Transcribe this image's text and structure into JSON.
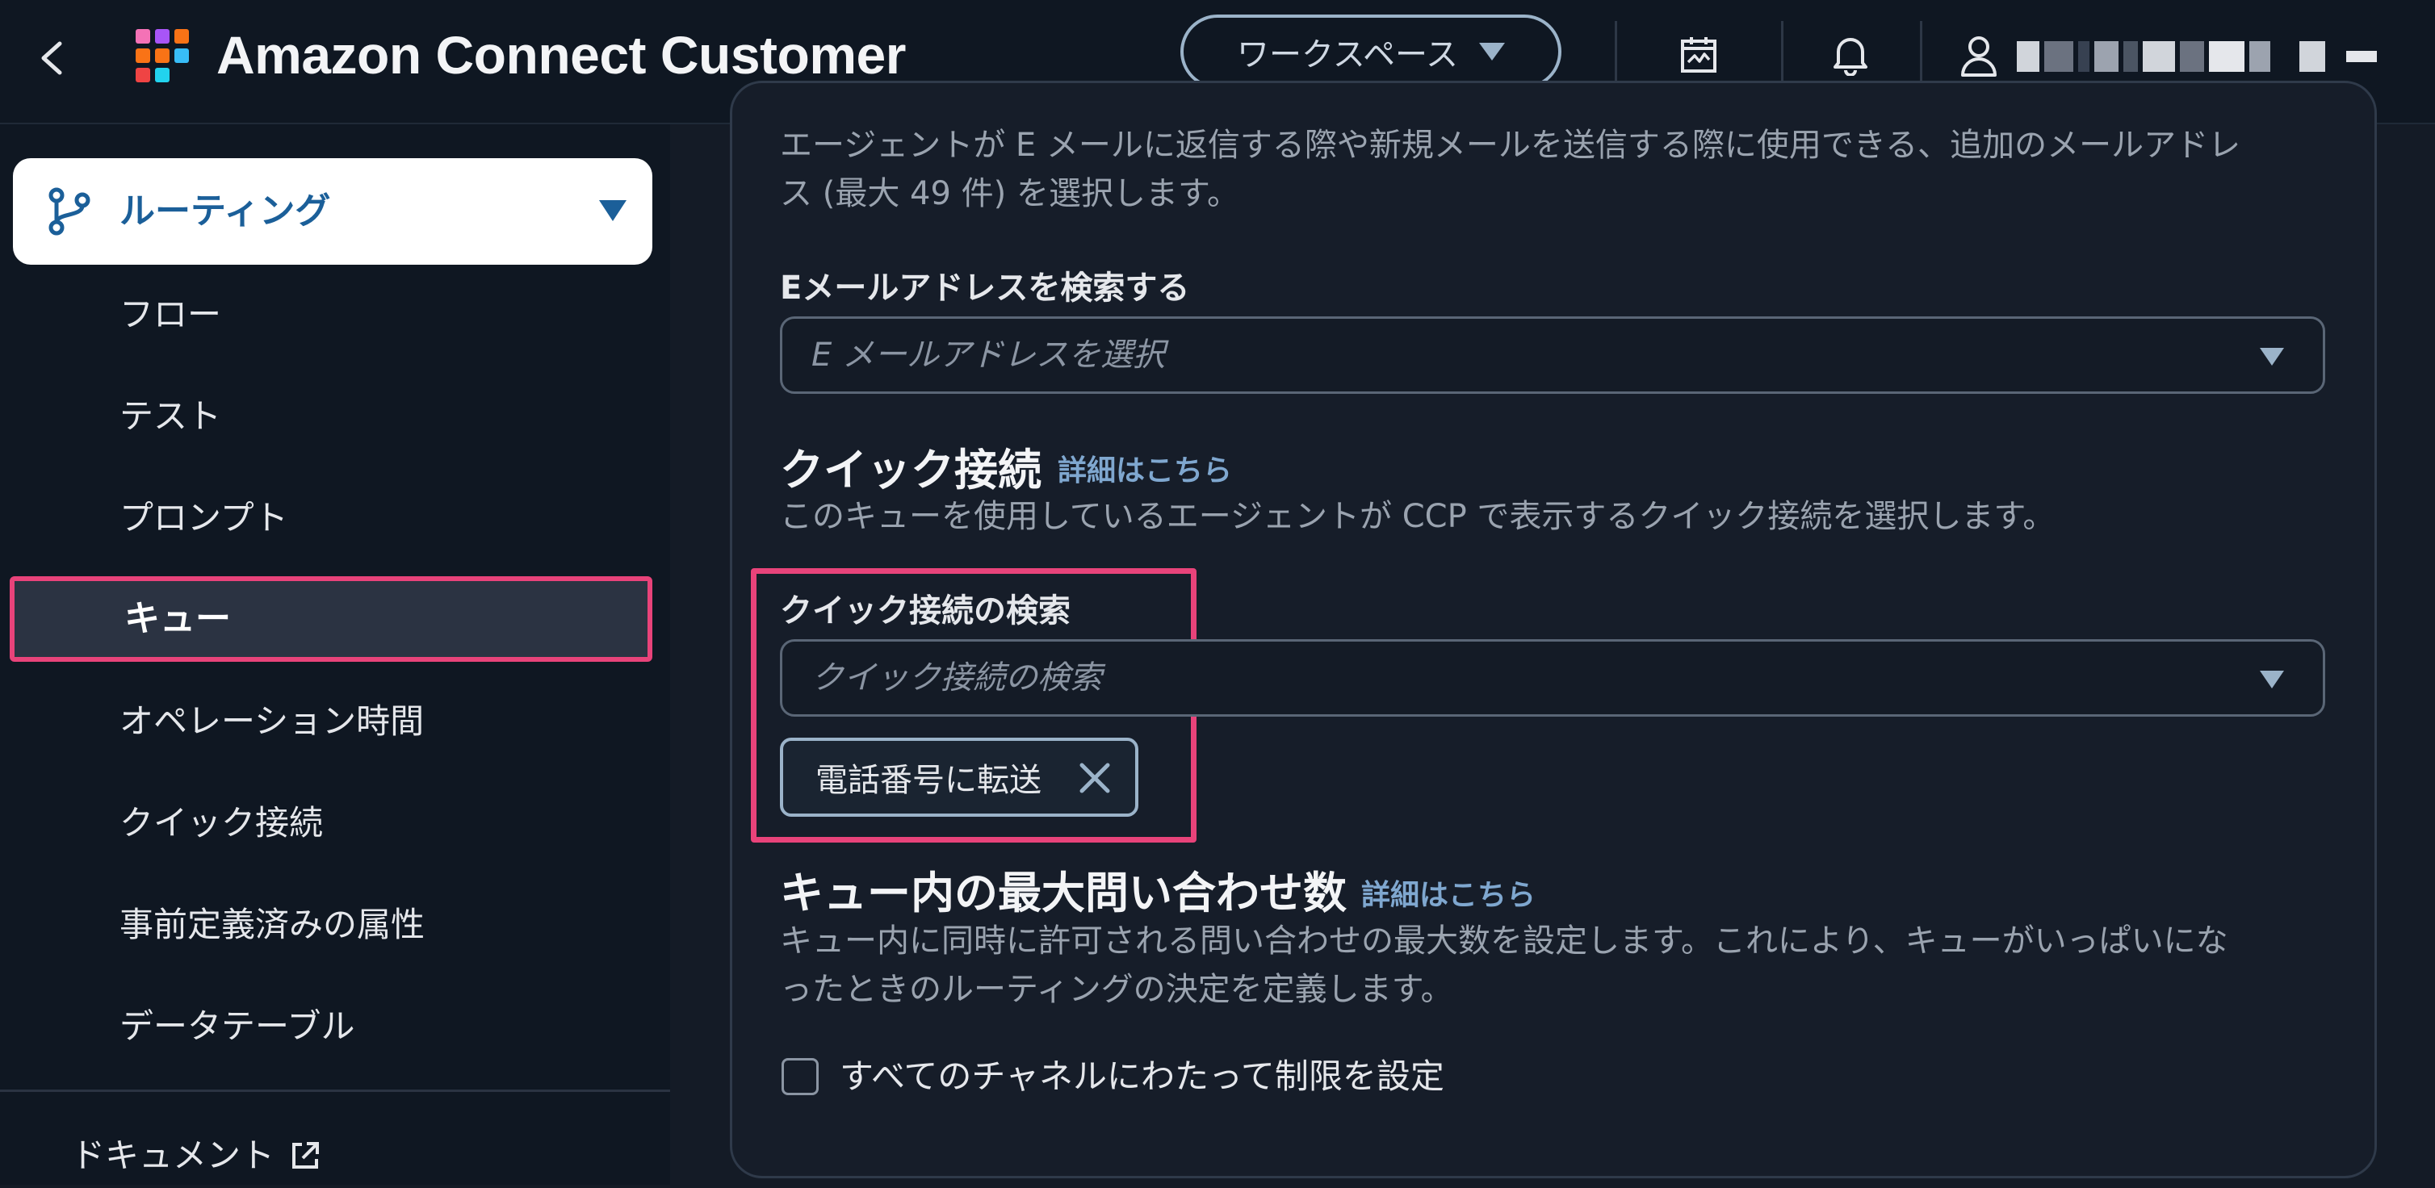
{
  "header": {
    "title": "Amazon Connect Customer",
    "back_icon": "chevron-left-icon",
    "workspace_label": "ワークスペース",
    "calendar_icon": "calendar-icon",
    "bell_icon": "bell-icon",
    "user_icon": "user-icon"
  },
  "sidebar": {
    "group_label": "ルーティング",
    "group_icon": "routing-branch-icon",
    "items": [
      {
        "label": "フロー"
      },
      {
        "label": "テスト"
      },
      {
        "label": "プロンプト"
      },
      {
        "label": "キュー"
      },
      {
        "label": "オペレーション時間"
      },
      {
        "label": "クイック接続"
      },
      {
        "label": "事前定義済みの属性"
      },
      {
        "label": "データテーブル"
      }
    ],
    "active_item": "キュー",
    "docs_label": "ドキュメント",
    "docs_icon": "external-link-icon"
  },
  "main": {
    "email": {
      "desc_line1": "エージェントが E メールに返信する際や新規メールを送信する際に使用できる、追加のメールアドレ",
      "desc_line2": "ス (最大 49 件) を選択します。",
      "label": "Eメールアドレスを検索する",
      "placeholder": "E メールアドレスを選択"
    },
    "quick_connect": {
      "title": "クイック接続",
      "learn_more": "詳細はこちら",
      "desc": "このキューを使用しているエージェントが CCP で表示するクイック接続を選択します。",
      "search_label": "クイック接続の検索",
      "search_placeholder": "クイック接続の検索",
      "selected_token": "電話番号に転送"
    },
    "max_contacts": {
      "title": "キュー内の最大問い合わせ数",
      "learn_more": "詳細はこちら",
      "desc_line1": "キュー内に同時に許可される問い合わせの最大数を設定します。これにより、キューがいっぱいにな",
      "desc_line2": "ったときのルーティングの決定を定義します。",
      "checkbox_label": "すべてのチャネルにわたって制限を設定",
      "checked": false
    }
  },
  "colors": {
    "background": "#141b26",
    "topbar": "#0f1722",
    "accent_link": "#7fa7cf",
    "highlight": "#e8437a",
    "routing_label": "#1b5f99"
  }
}
